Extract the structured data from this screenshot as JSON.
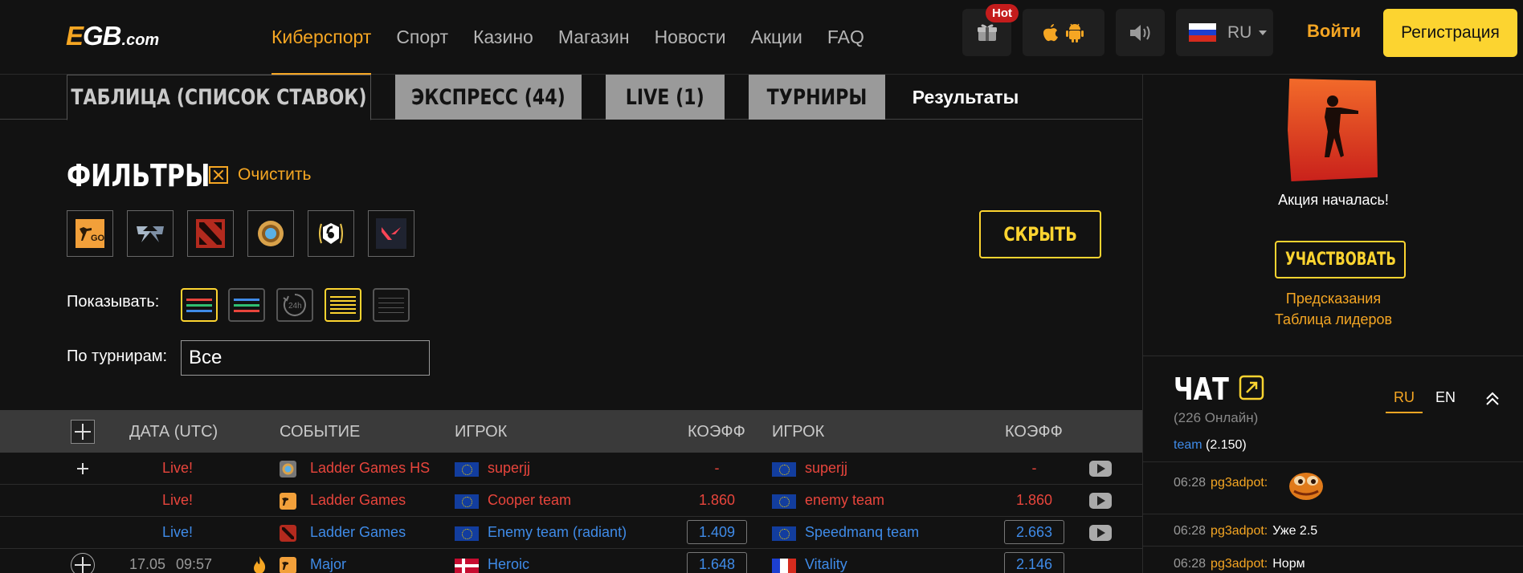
{
  "header": {
    "logo": {
      "e": "E",
      "gb": "GB",
      "com": ".com"
    },
    "nav": [
      "Киберспорт",
      "Спорт",
      "Казино",
      "Магазин",
      "Новости",
      "Акции",
      "FAQ"
    ],
    "hot_badge": "Hot",
    "lang": "RU",
    "login": "Войти",
    "register": "Регистрация",
    "colors": {
      "accent": "#f5a623",
      "yellow": "#fcd430",
      "hot": "#c41c1c"
    }
  },
  "tabs": [
    "ТАБЛИЦА (СПИСОК СТАВОК)",
    "ЭКСПРЕСС (44)",
    "LIVE (1)",
    "ТУРНИРЫ",
    "Результаты"
  ],
  "filters": {
    "title": "ФИЛЬТРЫ",
    "clear": "Очистить",
    "games": [
      "csgo-icon",
      "starcraft-icon",
      "dota2-icon",
      "hearthstone-icon",
      "rainbow-six-icon",
      "valorant-icon"
    ],
    "csgo_label": "GO",
    "hide": "СКРЫТЬ",
    "show_label": "Показывать:",
    "view_24h": "24h",
    "tournament_label": "По турнирам:",
    "tournament_value": "Все"
  },
  "table": {
    "headers": {
      "date": "ДАТА (UTC)",
      "event": "СОБЫТИЕ",
      "player1": "ИГРОК",
      "odds1": "КОЭФФ",
      "player2": "ИГРОК",
      "odds2": "КОЭФФ"
    },
    "rows": [
      {
        "date": "Live!",
        "event": "Ladder Games HS",
        "p1": "superjj",
        "o1": "-",
        "p2": "superjj",
        "o2": "-"
      },
      {
        "date": "Live!",
        "event": "Ladder Games",
        "p1": "Cooper team",
        "o1": "1.860",
        "p2": "enemy team",
        "o2": "1.860"
      },
      {
        "date": "Live!",
        "event": "Ladder Games",
        "p1": "Enemy team (radiant)",
        "o1": "1.409",
        "p2": "Speedmanq team",
        "o2": "2.663"
      },
      {
        "date": "17.05",
        "time": "09:57",
        "event": "Major",
        "p1": "Heroic",
        "o1": "1.648",
        "p2": "Vitality",
        "o2": "2.146"
      }
    ]
  },
  "sidebar": {
    "promo_text": "Акция началась!",
    "join": "УЧАСТВОВАТЬ",
    "predictions": "Предсказания",
    "leaderboard": "Таблица лидеров",
    "chat": {
      "title": "ЧАТ",
      "online": "(226 Онлайн)",
      "lang_ru": "RU",
      "lang_en": "EN",
      "partial_user": "team",
      "partial_value": "(2.150)",
      "messages": [
        {
          "time": "06:28",
          "user": "pg3adpot:",
          "text": ""
        },
        {
          "time": "06:28",
          "user": "pg3adpot:",
          "text": "Уже 2.5"
        },
        {
          "time": "06:28",
          "user": "pg3adpot:",
          "text": "Норм"
        }
      ]
    }
  }
}
